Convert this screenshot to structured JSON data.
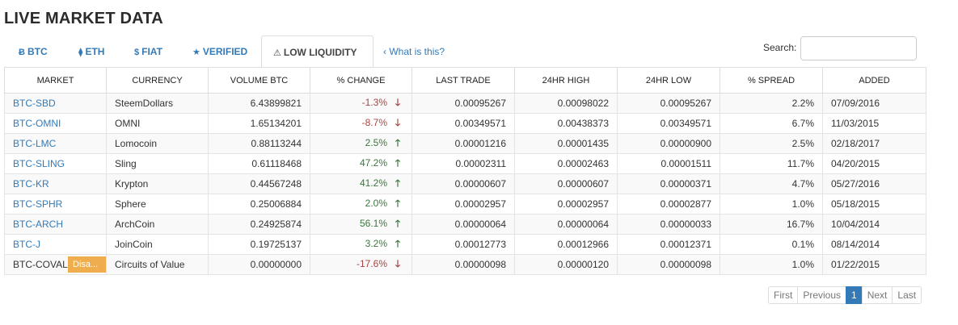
{
  "page": {
    "title": "LIVE MARKET DATA"
  },
  "tabs": [
    {
      "icon": "Ƀ",
      "label": "BTC"
    },
    {
      "icon": "⧫",
      "label": "ETH"
    },
    {
      "icon": "$",
      "label": "FIAT"
    },
    {
      "icon": "★",
      "label": "VERIFIED"
    },
    {
      "icon": "⚠",
      "label": "LOW LIQUIDITY"
    }
  ],
  "active_tab": "LOW LIQUIDITY",
  "what_is_this": {
    "icon": "‹",
    "label": "What is this?"
  },
  "search": {
    "label": "Search:",
    "value": "",
    "placeholder": ""
  },
  "table": {
    "headers": [
      "MARKET",
      "CURRENCY",
      "VOLUME BTC",
      "% CHANGE",
      "LAST TRADE",
      "24HR HIGH",
      "24HR LOW",
      "% SPREAD",
      "ADDED"
    ],
    "rows": [
      {
        "market": "BTC-SBD",
        "currency": "SteemDollars",
        "volume": "6.43899821",
        "change": "-1.3%",
        "direction": "down",
        "last": "0.00095267",
        "high": "0.00098022",
        "low": "0.00095267",
        "spread": "2.2%",
        "added": "07/09/2016"
      },
      {
        "market": "BTC-OMNI",
        "currency": "OMNI",
        "volume": "1.65134201",
        "change": "-8.7%",
        "direction": "down",
        "last": "0.00349571",
        "high": "0.00438373",
        "low": "0.00349571",
        "spread": "6.7%",
        "added": "11/03/2015"
      },
      {
        "market": "BTC-LMC",
        "currency": "Lomocoin",
        "volume": "0.88113244",
        "change": "2.5%",
        "direction": "up",
        "last": "0.00001216",
        "high": "0.00001435",
        "low": "0.00000900",
        "spread": "2.5%",
        "added": "02/18/2017"
      },
      {
        "market": "BTC-SLING",
        "currency": "Sling",
        "volume": "0.61118468",
        "change": "47.2%",
        "direction": "up",
        "last": "0.00002311",
        "high": "0.00002463",
        "low": "0.00001511",
        "spread": "11.7%",
        "added": "04/20/2015"
      },
      {
        "market": "BTC-KR",
        "currency": "Krypton",
        "volume": "0.44567248",
        "change": "41.2%",
        "direction": "up",
        "last": "0.00000607",
        "high": "0.00000607",
        "low": "0.00000371",
        "spread": "4.7%",
        "added": "05/27/2016"
      },
      {
        "market": "BTC-SPHR",
        "currency": "Sphere",
        "volume": "0.25006884",
        "change": "2.0%",
        "direction": "up",
        "last": "0.00002957",
        "high": "0.00002957",
        "low": "0.00002877",
        "spread": "1.0%",
        "added": "05/18/2015"
      },
      {
        "market": "BTC-ARCH",
        "currency": "ArchCoin",
        "volume": "0.24925874",
        "change": "56.1%",
        "direction": "up",
        "last": "0.00000064",
        "high": "0.00000064",
        "low": "0.00000033",
        "spread": "16.7%",
        "added": "10/04/2014"
      },
      {
        "market": "BTC-J",
        "currency": "JoinCoin",
        "volume": "0.19725137",
        "change": "3.2%",
        "direction": "up",
        "last": "0.00012773",
        "high": "0.00012966",
        "low": "0.00012371",
        "spread": "0.1%",
        "added": "08/14/2014"
      },
      {
        "market": "BTC-COVAL",
        "badge": "Disa...",
        "currency": "Circuits of Value",
        "volume": "0.00000000",
        "change": "-17.6%",
        "direction": "down",
        "last": "0.00000098",
        "high": "0.00000120",
        "low": "0.00000098",
        "spread": "1.0%",
        "added": "01/22/2015"
      }
    ]
  },
  "pagination": {
    "items": [
      "First",
      "Previous",
      "1",
      "Next",
      "Last"
    ],
    "active": "1"
  },
  "colors": {
    "link": "#337ab7",
    "up": "#3c763d",
    "down": "#a94442",
    "badge": "#f0ad4e"
  },
  "icons": {
    "up_arrow": "🡑",
    "down_arrow": "🡓"
  }
}
